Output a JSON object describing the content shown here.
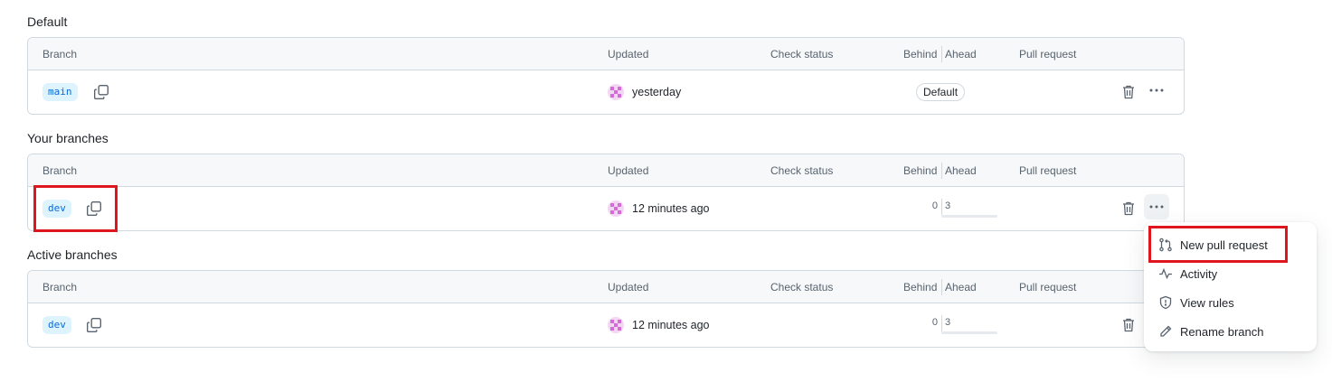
{
  "sections": [
    {
      "title": "Default"
    },
    {
      "title": "Your branches"
    },
    {
      "title": "Active branches"
    }
  ],
  "columns": {
    "branch": "Branch",
    "updated": "Updated",
    "check_status": "Check status",
    "behind": "Behind",
    "ahead": "Ahead",
    "pull_request": "Pull request"
  },
  "rows": [
    {
      "branch": "main",
      "updated": "yesterday",
      "badge": "Default"
    },
    {
      "branch": "dev",
      "updated": "12 minutes ago",
      "behind": "0",
      "ahead": "3"
    },
    {
      "branch": "dev",
      "updated": "12 minutes ago",
      "behind": "0",
      "ahead": "3"
    }
  ],
  "icons": {
    "copy": "copy-icon",
    "trash": "trash-icon",
    "kebab": "kebab-horizontal-icon",
    "avatar": "user-avatar-identicon"
  },
  "menu": {
    "items": [
      {
        "label": "New pull request",
        "icon": "git-pull-request-icon"
      },
      {
        "label": "Activity",
        "icon": "pulse-icon"
      },
      {
        "label": "View rules",
        "icon": "shield-icon"
      },
      {
        "label": "Rename branch",
        "icon": "pencil-icon"
      }
    ]
  },
  "colors": {
    "accent": "#0969da",
    "branch_tag_bg": "#ddf4ff",
    "header_bg": "#f6f8fa",
    "border": "#d1d9e0",
    "highlight": "#e0161f",
    "avatar": "#d56bd6"
  }
}
